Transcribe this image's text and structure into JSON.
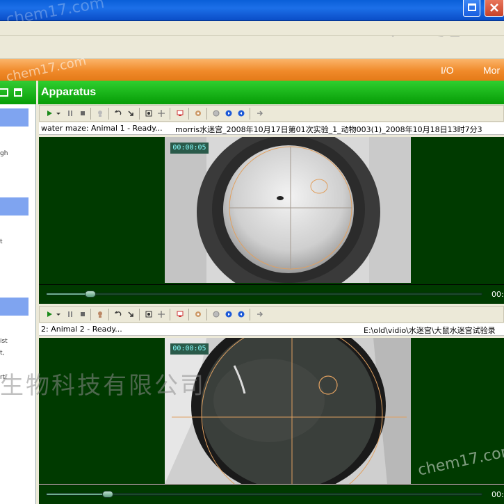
{
  "watermarks": {
    "site": "chem17.com",
    "company": "生物科技有限公司"
  },
  "menubar": {
    "io": "I/O",
    "mon": "Mor"
  },
  "left_panel": {
    "texts": [
      "gh",
      "t",
      "ist",
      "t,",
      "rt."
    ]
  },
  "apparatus": {
    "title": "Apparatus",
    "panes": [
      {
        "status_left": "water maze: Animal 1 - Ready...",
        "status_right": "morris水迷宫_2008年10月17日第01次实验_1_动物003(1)_2008年10月18日13时7分3",
        "time": "00:00:05",
        "seek_end": "00:",
        "progress": 0.1
      },
      {
        "status_left": "2: Animal 2 - Ready...",
        "status_right": "E:\\old\\vidio\\水迷宫\\大鼠水迷宫试验录",
        "time": "00:00:05",
        "seek_end": "00:",
        "progress": 0.14
      }
    ]
  },
  "icons": [
    "play-icon",
    "dropdown-arrow-icon",
    "pause-icon",
    "stop-icon",
    "animal-icon",
    "undo-icon",
    "redo-icon",
    "zoom-fit-icon",
    "move-icon",
    "color-picker-icon",
    "settings-icon",
    "record-icon",
    "forward-icon",
    "back-icon",
    "arrow-right-icon"
  ],
  "colors": {
    "green_header": "#079e07",
    "orange_bar": "#f08a2a",
    "video_bg": "#003a00",
    "arena_ring": "#e0a060"
  }
}
